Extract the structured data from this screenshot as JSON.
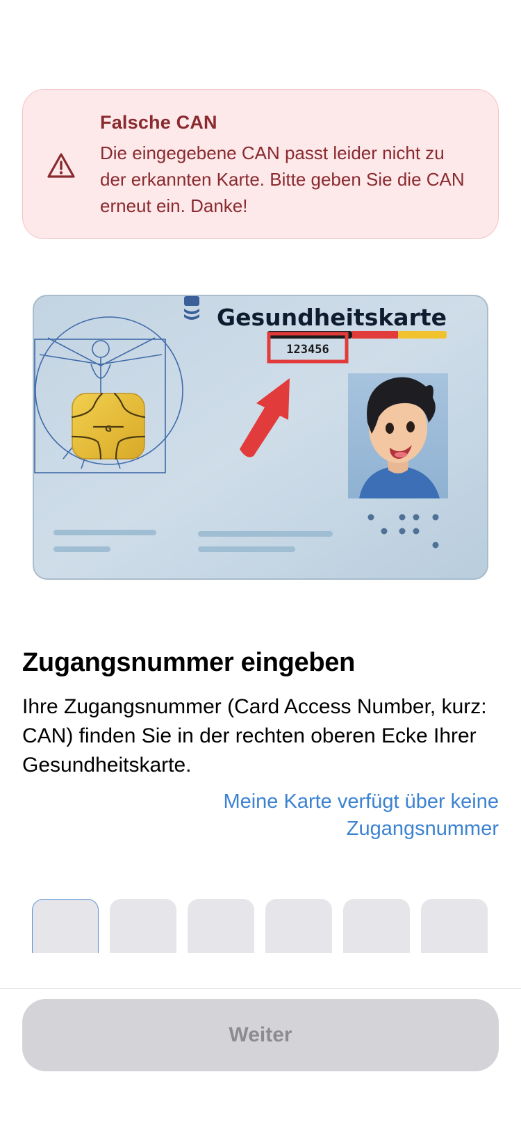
{
  "error": {
    "icon": "warning-triangle-icon",
    "title": "Falsche CAN",
    "message": "Die eingegebene CAN passt leider nicht zu der erkannten Karte. Bitte geben Sie die CAN erneut ein. Danke!"
  },
  "card": {
    "card_title": "Gesundheitskarte",
    "can_example": "123456",
    "chip_logo": "G"
  },
  "info": {
    "title": "Zugangsnummer eingeben",
    "description": "Ihre Zugangsnummer (Card Access Number, kurz: CAN) finden Sie in der rechten oberen Ecke Ihrer Gesundheitskarte.",
    "no_can_link": "Meine Karte verfügt über keine Zugangsnummer"
  },
  "can_input": {
    "digits": [
      "",
      "",
      "",
      "",
      "",
      ""
    ]
  },
  "footer": {
    "continue_label": "Weiter"
  },
  "colors": {
    "error_text": "#8a2a2f",
    "error_bg": "#fde9ea",
    "link": "#3b82d1",
    "button_disabled_bg": "#d3d3d8",
    "button_disabled_text": "#8b8b90"
  }
}
